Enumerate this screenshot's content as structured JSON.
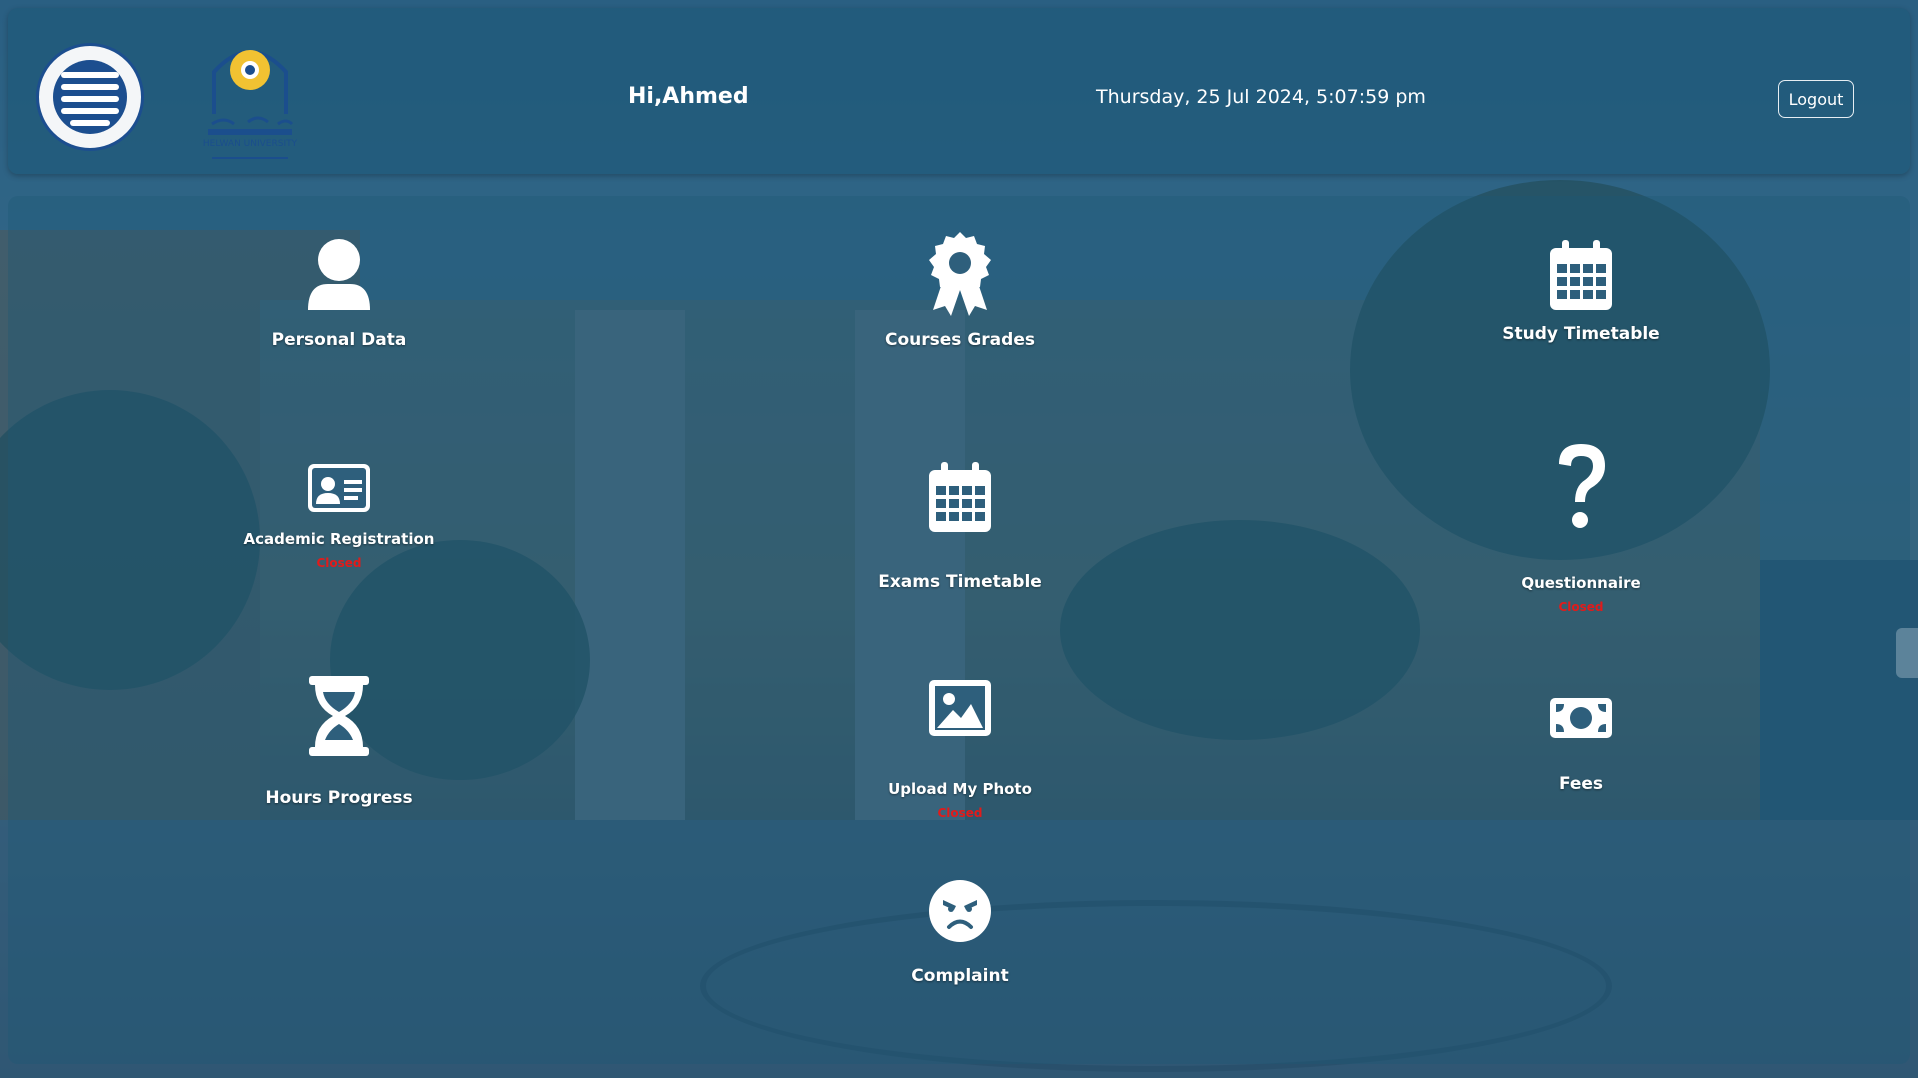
{
  "header": {
    "greeting": "Hi,Ahmed",
    "datetime": "Thursday, 25 Jul 2024, 5:07:59 pm",
    "logout_label": "Logout",
    "logo_university_text": "HELWAN UNIVERSITY"
  },
  "tiles": [
    {
      "label": "Personal Data",
      "icon": "user-icon"
    },
    {
      "label": "Courses Grades",
      "icon": "award-icon"
    },
    {
      "label": "Study Timetable",
      "icon": "calendar-icon"
    },
    {
      "label": "Academic Registration",
      "icon": "id-card-icon",
      "status": "Closed"
    },
    {
      "label": "Exams Timetable",
      "icon": "calendar-icon"
    },
    {
      "label": "Questionnaire",
      "icon": "question-icon",
      "status": "Closed"
    },
    {
      "label": "Hours Progress",
      "icon": "hourglass-icon"
    },
    {
      "label": "Upload My Photo",
      "icon": "image-icon",
      "status": "Closed"
    },
    {
      "label": "Fees",
      "icon": "money-icon"
    },
    {
      "label": "Complaint",
      "icon": "angry-face-icon"
    }
  ],
  "colors": {
    "overlay": "#1e567a",
    "status_closed": "#e11b1b",
    "text": "#ffffff"
  }
}
